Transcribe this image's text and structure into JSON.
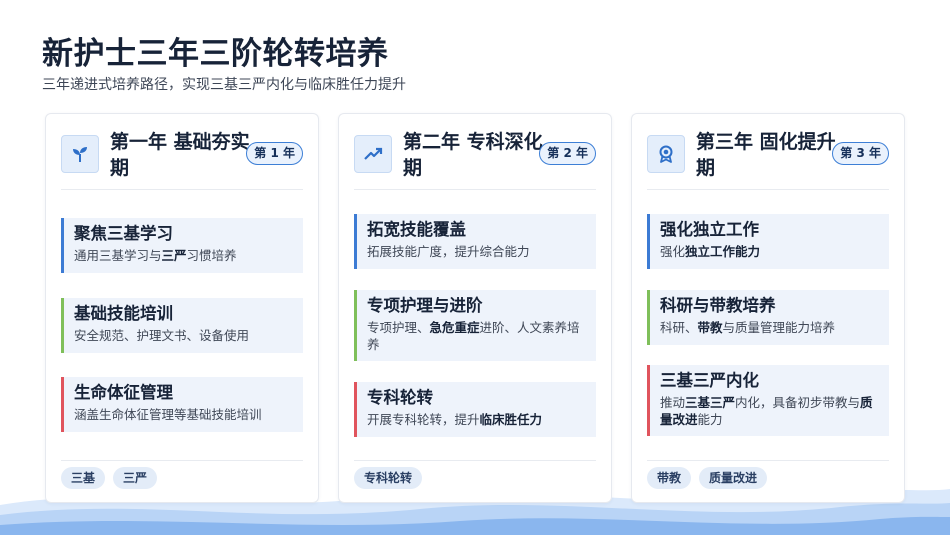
{
  "title": "新护士三年三阶轮转培养",
  "subtitle": "三年递进式培养路径，实现三基三严内化与临床胜任力提升",
  "colors": {
    "accent_blue": "#3c7bd4",
    "accent_green": "#7fbf5a",
    "accent_red": "#e0545d"
  },
  "cards": [
    {
      "icon": "sprout-icon",
      "title": "第一年 基础夯实期",
      "badge": "第 1 年",
      "items": [
        {
          "title": "聚焦三基学习",
          "desc_pre": "通用三基学习与",
          "desc_bold": "三严",
          "desc_post": "习惯培养",
          "color": "blue"
        },
        {
          "title": "基础技能培训",
          "desc_pre": "安全规范、护理文书、设备使用",
          "desc_bold": "",
          "desc_post": "",
          "color": "green"
        },
        {
          "title": "生命体征管理",
          "desc_pre": "涵盖生命体征管理等基础技能培训",
          "desc_bold": "",
          "desc_post": "",
          "color": "red"
        }
      ],
      "tags": [
        "三基",
        "三严"
      ]
    },
    {
      "icon": "trend-up-icon",
      "title": "第二年 专科深化期",
      "badge": "第 2 年",
      "items": [
        {
          "title": "拓宽技能覆盖",
          "desc_pre": "拓展技能广度，提升综合能力",
          "desc_bold": "",
          "desc_post": "",
          "color": "blue"
        },
        {
          "title": "专项护理与进阶",
          "desc_pre": "专项护理、",
          "desc_bold": "急危重症",
          "desc_post": "进阶、人文素养培养",
          "color": "green"
        },
        {
          "title": "专科轮转",
          "desc_pre": "开展专科轮转，提升",
          "desc_bold": "临床胜任力",
          "desc_post": "",
          "color": "red"
        }
      ],
      "tags": [
        "专科轮转"
      ]
    },
    {
      "icon": "award-icon",
      "title": "第三年 固化提升期",
      "badge": "第 3 年",
      "items": [
        {
          "title": "强化独立工作",
          "desc_pre": "强化",
          "desc_bold": "独立工作能力",
          "desc_post": "",
          "color": "blue"
        },
        {
          "title": "科研与带教培养",
          "desc_pre": "科研、",
          "desc_bold": "带教",
          "desc_post": "与质量管理能力培养",
          "color": "green"
        },
        {
          "title": "三基三严内化",
          "desc_pre": "推动",
          "desc_bold": "三基三严",
          "desc_post": "内化，具备初步带教与",
          "desc_bold2": "质量改进",
          "desc_post2": "能力",
          "color": "red"
        }
      ],
      "tags": [
        "带教",
        "质量改进"
      ]
    }
  ]
}
